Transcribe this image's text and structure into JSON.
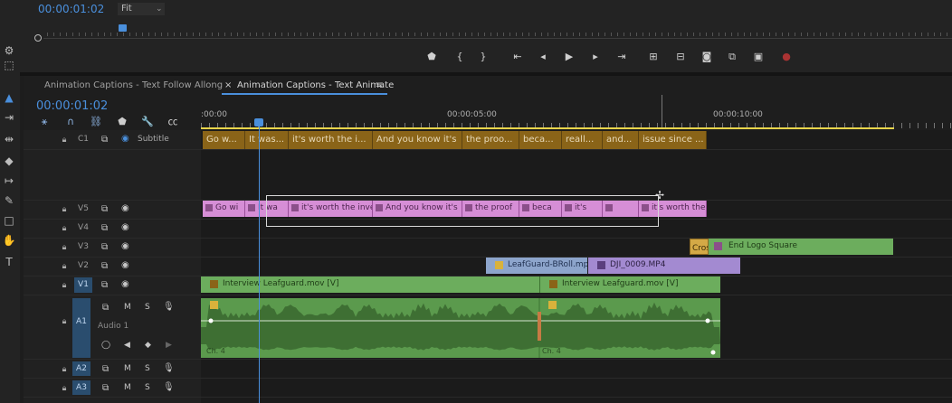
{
  "monitor": {
    "timecode": "00:00:01:02",
    "fit": "Fit"
  },
  "tabs": [
    {
      "label": "Animation Captions - Text Follow Allong"
    },
    {
      "label": "Animation Captions - Text Animate"
    }
  ],
  "sequence": {
    "timecode": "00:00:01:02",
    "ruler_labels": [
      ":00:00",
      "00:00:05:00",
      "00:00:10:00"
    ]
  },
  "tracks": {
    "subtitle": {
      "label": "C1",
      "name": "Subtitle"
    },
    "video": [
      "V5",
      "V4",
      "V3",
      "V2",
      "V1"
    ],
    "audio": [
      "A1",
      "A2",
      "A3"
    ],
    "audio1_name": "Audio 1",
    "mute_label": "M",
    "solo_label": "S"
  },
  "captions": [
    "Go w...",
    "It was...",
    "it's worth the i...",
    "And you know it's",
    "the proo...",
    "beca...",
    "reall...",
    "and...",
    "issue since ..."
  ],
  "v5_clips": [
    "Go wi",
    "It wa",
    "it's worth the inve",
    "And you know it's",
    "the proof",
    "beca",
    "it's",
    "",
    "it's worth the"
  ],
  "v3_clips": {
    "small": "Cros",
    "main": "End Logo Square"
  },
  "v2_clips": [
    "LeafGuard-BRoll.mp4",
    "DJI_0009.MP4"
  ],
  "v1_clips": [
    "Interview Leafguard.mov [V]",
    "Interview Leafguard.mov [V]"
  ],
  "audio_labels": [
    "Ch. 4",
    "Ch. 4"
  ],
  "icons": [
    "selection-tool",
    "ripple-tool",
    "razor-tool",
    "slip-tool",
    "pen-tool",
    "hand-tool",
    "type-tool",
    "marker-icon",
    "play-icon",
    "camera-icon"
  ]
}
